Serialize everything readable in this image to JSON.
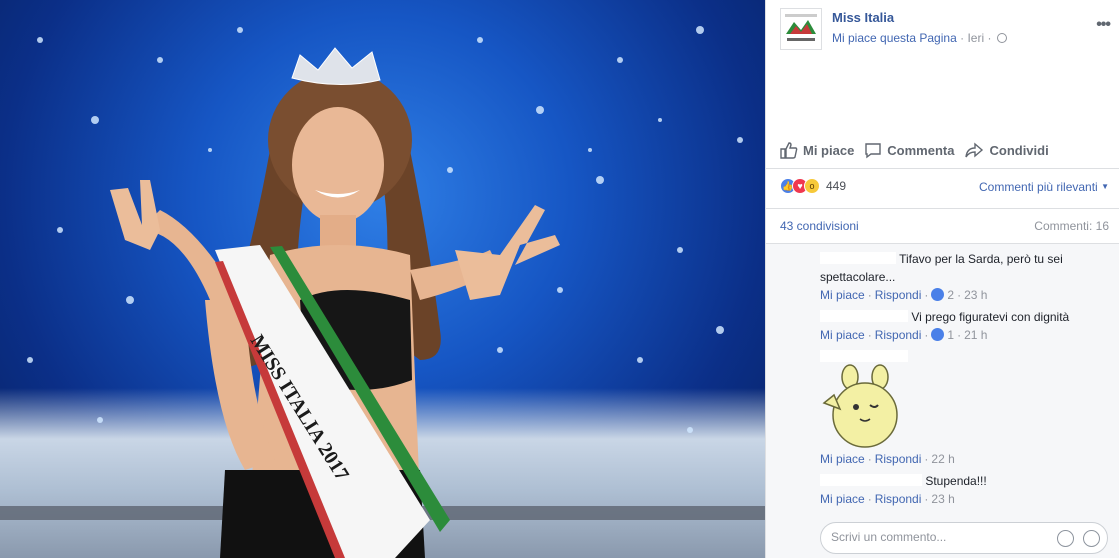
{
  "page": {
    "name": "Miss Italia",
    "like_link": "Mi piace questa Pagina",
    "timestamp": "Ieri",
    "logo_icon": "miss-italia-logo"
  },
  "photo": {
    "sash_text": "MISS ITALIA 2017"
  },
  "actions": {
    "like": "Mi piace",
    "comment": "Commenta",
    "share": "Condividi"
  },
  "stats": {
    "reactions_count": "449",
    "sort_label": "Commenti più rilevanti",
    "shares": "43 condivisioni",
    "comments": "Commenti: 16"
  },
  "comments": [
    {
      "text": "Tifavo per la Sarda, però tu sei spettacolare...",
      "like": "Mi piace",
      "reply": "Rispondi",
      "likes": "2",
      "time": "23 h"
    },
    {
      "text": "Vi prego figuratevi con dignità",
      "like": "Mi piace",
      "reply": "Rispondi",
      "likes": "1",
      "time": "21 h"
    },
    {
      "sticker": "bunny-sticker-icon",
      "like": "Mi piace",
      "reply": "Rispondi",
      "time": "22 h"
    },
    {
      "text": "Stupenda!!!",
      "like": "Mi piace",
      "reply": "Rispondi",
      "time": "23 h"
    }
  ],
  "composer": {
    "placeholder": "Scrivi un commento..."
  },
  "colors": {
    "link": "#4267b2",
    "name": "#365899",
    "like_blue": "#4a80e8",
    "love_red": "#f0384f",
    "wow_yellow": "#f7c93a"
  }
}
